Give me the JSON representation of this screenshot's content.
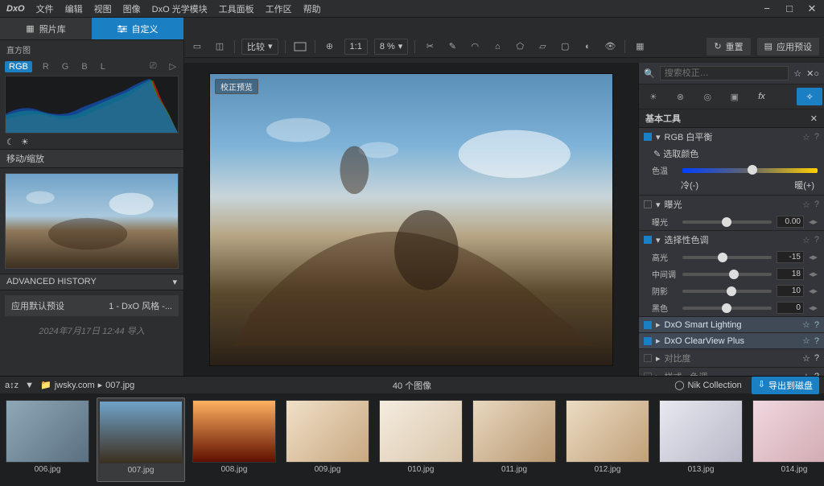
{
  "menu": {
    "logo": "DxO",
    "items": [
      "文件",
      "编辑",
      "视图",
      "图像",
      "DxO 光学模块",
      "工具面板",
      "工作区",
      "帮助"
    ]
  },
  "tabs": {
    "library": "照片库",
    "custom": "自定义"
  },
  "toolbar": {
    "compare": "比较",
    "zoom_fit": "1:1",
    "zoom_pct": "8 %",
    "reset": "重置",
    "preset": "应用预设"
  },
  "histogram": {
    "title": "直方图",
    "rgb": "RGB",
    "r": "R",
    "g": "G",
    "b": "B",
    "l": "L"
  },
  "move": {
    "title": "移动/缩放"
  },
  "advanced": {
    "title": "ADVANCED HISTORY"
  },
  "history": {
    "action": "应用默认预设",
    "style": "1 - DxO 风格 -...",
    "ts": "2024年7月17日 12:44 导入"
  },
  "viewer": {
    "badge": "校正预览"
  },
  "right": {
    "search_ph": "搜索校正…",
    "basic_tools": "基本工具",
    "wb": {
      "name": "RGB 白平衡",
      "pick": "选取颜色",
      "temp": "色温",
      "cold": "冷(-)",
      "warm": "暖(+)"
    },
    "exposure": {
      "name": "曝光",
      "lbl": "曝光",
      "val": "0.00"
    },
    "selective": {
      "name": "选择性色调",
      "rows": [
        {
          "lbl": "高光",
          "val": "-15",
          "pos": 45
        },
        {
          "lbl": "中间调",
          "val": "18",
          "pos": 58
        },
        {
          "lbl": "阴影",
          "val": "10",
          "pos": 55
        },
        {
          "lbl": "黑色",
          "val": "0",
          "pos": 50
        }
      ]
    },
    "smart": "DxO Smart Lighting",
    "clearview": "DxO ClearView Plus",
    "contrast": "对比度",
    "style": "样式 - 色调"
  },
  "strip": {
    "sort": "a↕z",
    "filter": "▼",
    "folder": "jwsky.com",
    "file": "007.jpg",
    "count": "40 个图像",
    "nik": "Nik Collection",
    "export": "导出到磁盘",
    "thumbs": [
      {
        "name": "006.jpg"
      },
      {
        "name": "007.jpg"
      },
      {
        "name": "008.jpg"
      },
      {
        "name": "009.jpg"
      },
      {
        "name": "010.jpg"
      },
      {
        "name": "011.jpg"
      },
      {
        "name": "012.jpg"
      },
      {
        "name": "013.jpg"
      },
      {
        "name": "014.jpg"
      }
    ]
  }
}
